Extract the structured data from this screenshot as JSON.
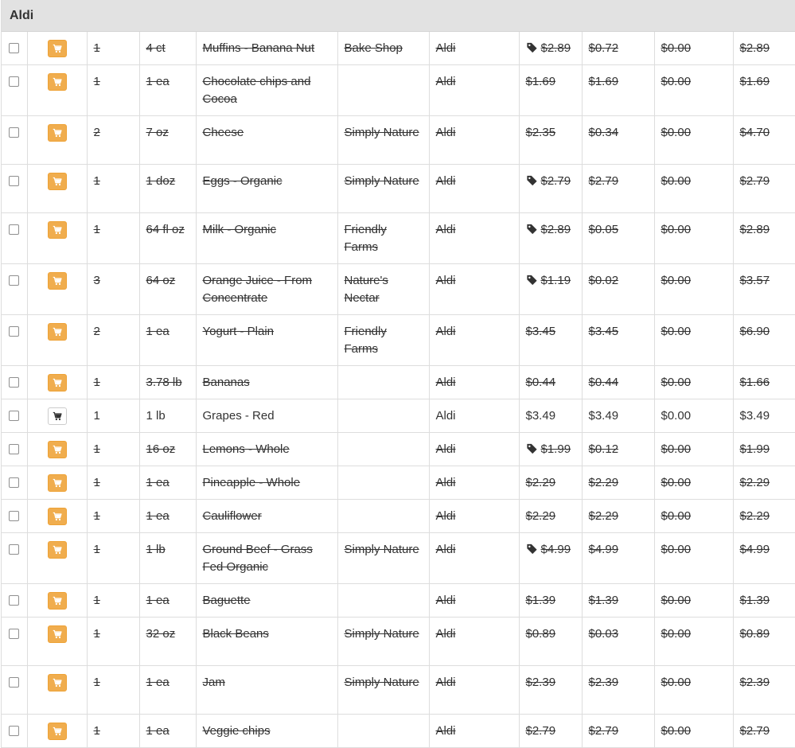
{
  "store": {
    "name": "Aldi"
  },
  "colors": {
    "cart_active": "#f0ad4e",
    "header_bg": "#e2e2e2",
    "border": "#dddddd"
  },
  "items": [
    {
      "qty": "1",
      "size": "4 ct",
      "name": "Muffins - Banana Nut",
      "brand": "Bake Shop",
      "store": "Aldi",
      "price": "$2.89",
      "unit": "$0.72",
      "tax": "$0.00",
      "total": "$2.89",
      "tag": true,
      "purchased": true,
      "rows": 1
    },
    {
      "qty": "1",
      "size": "1 ea",
      "name": "Chocolate chips and Cocoa",
      "brand": "",
      "store": "Aldi",
      "price": "$1.69",
      "unit": "$1.69",
      "tax": "$0.00",
      "total": "$1.69",
      "tag": false,
      "purchased": true,
      "rows": 2
    },
    {
      "qty": "2",
      "size": "7 oz",
      "name": "Cheese",
      "brand": "Simply Nature",
      "store": "Aldi",
      "price": "$2.35",
      "unit": "$0.34",
      "tax": "$0.00",
      "total": "$4.70",
      "tag": false,
      "purchased": true,
      "rows": 2
    },
    {
      "qty": "1",
      "size": "1 doz",
      "name": "Eggs - Organic",
      "brand": "Simply Nature",
      "store": "Aldi",
      "price": "$2.79",
      "unit": "$2.79",
      "tax": "$0.00",
      "total": "$2.79",
      "tag": true,
      "purchased": true,
      "rows": 2
    },
    {
      "qty": "1",
      "size": "64 fl oz",
      "name": "Milk - Organic",
      "brand": "Friendly Farms",
      "store": "Aldi",
      "price": "$2.89",
      "unit": "$0.05",
      "tax": "$0.00",
      "total": "$2.89",
      "tag": true,
      "purchased": true,
      "rows": 2
    },
    {
      "qty": "3",
      "size": "64 oz",
      "name": "Orange Juice - From Concentrate",
      "brand": "Nature's Nectar",
      "store": "Aldi",
      "price": "$1.19",
      "unit": "$0.02",
      "tax": "$0.00",
      "total": "$3.57",
      "tag": true,
      "purchased": true,
      "rows": 2
    },
    {
      "qty": "2",
      "size": "1 ea",
      "name": "Yogurt - Plain",
      "brand": "Friendly Farms",
      "store": "Aldi",
      "price": "$3.45",
      "unit": "$3.45",
      "tax": "$0.00",
      "total": "$6.90",
      "tag": false,
      "purchased": true,
      "rows": 2
    },
    {
      "qty": "1",
      "size": "3.78 lb",
      "name": "Bananas",
      "brand": "",
      "store": "Aldi",
      "price": "$0.44",
      "unit": "$0.44",
      "tax": "$0.00",
      "total": "$1.66",
      "tag": false,
      "purchased": true,
      "rows": 1
    },
    {
      "qty": "1",
      "size": "1 lb",
      "name": "Grapes - Red",
      "brand": "",
      "store": "Aldi",
      "price": "$3.49",
      "unit": "$3.49",
      "tax": "$0.00",
      "total": "$3.49",
      "tag": false,
      "purchased": false,
      "rows": 1
    },
    {
      "qty": "1",
      "size": "16 oz",
      "name": "Lemons - Whole",
      "brand": "",
      "store": "Aldi",
      "price": "$1.99",
      "unit": "$0.12",
      "tax": "$0.00",
      "total": "$1.99",
      "tag": true,
      "purchased": true,
      "rows": 1
    },
    {
      "qty": "1",
      "size": "1 ea",
      "name": "Pineapple - Whole",
      "brand": "",
      "store": "Aldi",
      "price": "$2.29",
      "unit": "$2.29",
      "tax": "$0.00",
      "total": "$2.29",
      "tag": false,
      "purchased": true,
      "rows": 1
    },
    {
      "qty": "1",
      "size": "1 ea",
      "name": "Cauliflower",
      "brand": "",
      "store": "Aldi",
      "price": "$2.29",
      "unit": "$2.29",
      "tax": "$0.00",
      "total": "$2.29",
      "tag": false,
      "purchased": true,
      "rows": 1
    },
    {
      "qty": "1",
      "size": "1 lb",
      "name": "Ground Beef - Grass Fed Organic",
      "brand": "Simply Nature",
      "store": "Aldi",
      "price": "$4.99",
      "unit": "$4.99",
      "tax": "$0.00",
      "total": "$4.99",
      "tag": true,
      "purchased": true,
      "rows": 2
    },
    {
      "qty": "1",
      "size": "1 ea",
      "name": "Baguette",
      "brand": "",
      "store": "Aldi",
      "price": "$1.39",
      "unit": "$1.39",
      "tax": "$0.00",
      "total": "$1.39",
      "tag": false,
      "purchased": true,
      "rows": 1
    },
    {
      "qty": "1",
      "size": "32 oz",
      "name": "Black Beans",
      "brand": "Simply Nature",
      "store": "Aldi",
      "price": "$0.89",
      "unit": "$0.03",
      "tax": "$0.00",
      "total": "$0.89",
      "tag": false,
      "purchased": true,
      "rows": 2
    },
    {
      "qty": "1",
      "size": "1 ea",
      "name": "Jam",
      "brand": "Simply Nature",
      "store": "Aldi",
      "price": "$2.39",
      "unit": "$2.39",
      "tax": "$0.00",
      "total": "$2.39",
      "tag": false,
      "purchased": true,
      "rows": 2
    },
    {
      "qty": "1",
      "size": "1 ea",
      "name": "Veggie chips",
      "brand": "",
      "store": "Aldi",
      "price": "$2.79",
      "unit": "$2.79",
      "tax": "$0.00",
      "total": "$2.79",
      "tag": false,
      "purchased": true,
      "rows": 1
    }
  ]
}
